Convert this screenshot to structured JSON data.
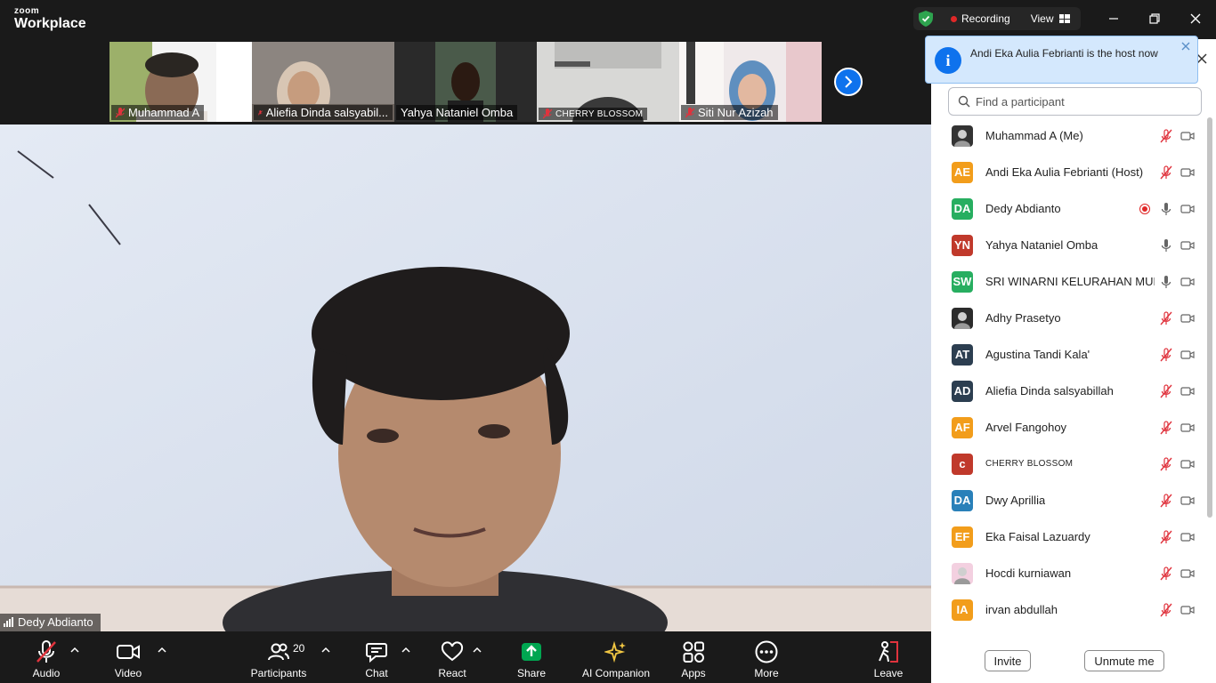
{
  "app": {
    "brand_small": "zoom",
    "brand_big": "Workplace",
    "recording_label": "Recording",
    "view_label": "View"
  },
  "colors": {
    "accent": "#0e72ed",
    "recording": "#e02828",
    "muted": "#e0333d",
    "share": "#00a651",
    "ai": "#f3c843"
  },
  "thumbnails": [
    {
      "name": "Muhammad A",
      "muted": true
    },
    {
      "name": "Aliefia Dinda salsyabil...",
      "muted": true
    },
    {
      "name": "Yahya Nataniel Omba",
      "muted": false
    },
    {
      "name": "CHERRY BLOSSOM",
      "muted": true
    },
    {
      "name": "Siti Nur Azizah",
      "muted": true
    }
  ],
  "speaker": {
    "name": "Dedy Abdianto"
  },
  "toolbar": {
    "audio": "Audio",
    "video": "Video",
    "participants": "Participants",
    "participants_count": "20",
    "chat": "Chat",
    "react": "React",
    "share": "Share",
    "ai_companion": "AI Companion",
    "apps": "Apps",
    "more": "More",
    "leave": "Leave"
  },
  "notification": {
    "message": "Andi Eka Aulia Febrianti is the host now"
  },
  "panel": {
    "search_placeholder": "Find a participant",
    "invite": "Invite",
    "unmute_me": "Unmute me",
    "participants": [
      {
        "initials": "",
        "name": "Muhammad A (Me)",
        "color": "#333333",
        "mic": "muted",
        "photo": true
      },
      {
        "initials": "AE",
        "name": "Andi Eka Aulia Febrianti (Host)",
        "color": "#f29d1b",
        "mic": "muted"
      },
      {
        "initials": "DA",
        "name": "Dedy Abdianto",
        "color": "#27ae60",
        "mic": "on",
        "recording": true
      },
      {
        "initials": "YN",
        "name": "Yahya Nataniel Omba",
        "color": "#c0392b",
        "mic": "on"
      },
      {
        "initials": "SW",
        "name": "SRI WINARNI KELURAHAN MULI",
        "color": "#27ae60",
        "mic": "on"
      },
      {
        "initials": "",
        "name": "Adhy Prasetyo",
        "color": "#2b2b2b",
        "mic": "muted",
        "photo": true
      },
      {
        "initials": "AT",
        "name": "Agustina Tandi Kala'",
        "color": "#2c3e50",
        "mic": "muted"
      },
      {
        "initials": "AD",
        "name": "Aliefia Dinda salsyabillah",
        "color": "#2c3e50",
        "mic": "muted"
      },
      {
        "initials": "AF",
        "name": "Arvel Fangohoy",
        "color": "#f29d1b",
        "mic": "muted"
      },
      {
        "initials": "c",
        "name": "CHERRY BLOSSOM",
        "color": "#c0392b",
        "mic": "muted",
        "caps": true
      },
      {
        "initials": "DA",
        "name": "Dwy Aprillia",
        "color": "#2980b9",
        "mic": "muted"
      },
      {
        "initials": "EF",
        "name": "Eka Faisal Lazuardy",
        "color": "#f29d1b",
        "mic": "muted"
      },
      {
        "initials": "",
        "name": "Hocdi kurniawan",
        "color": "#f3d0e0",
        "mic": "muted",
        "photo": true
      },
      {
        "initials": "IA",
        "name": "irvan abdullah",
        "color": "#f29d1b",
        "mic": "muted"
      },
      {
        "initials": "",
        "name": "",
        "color": "#1abc9c",
        "mic": "muted"
      }
    ]
  }
}
